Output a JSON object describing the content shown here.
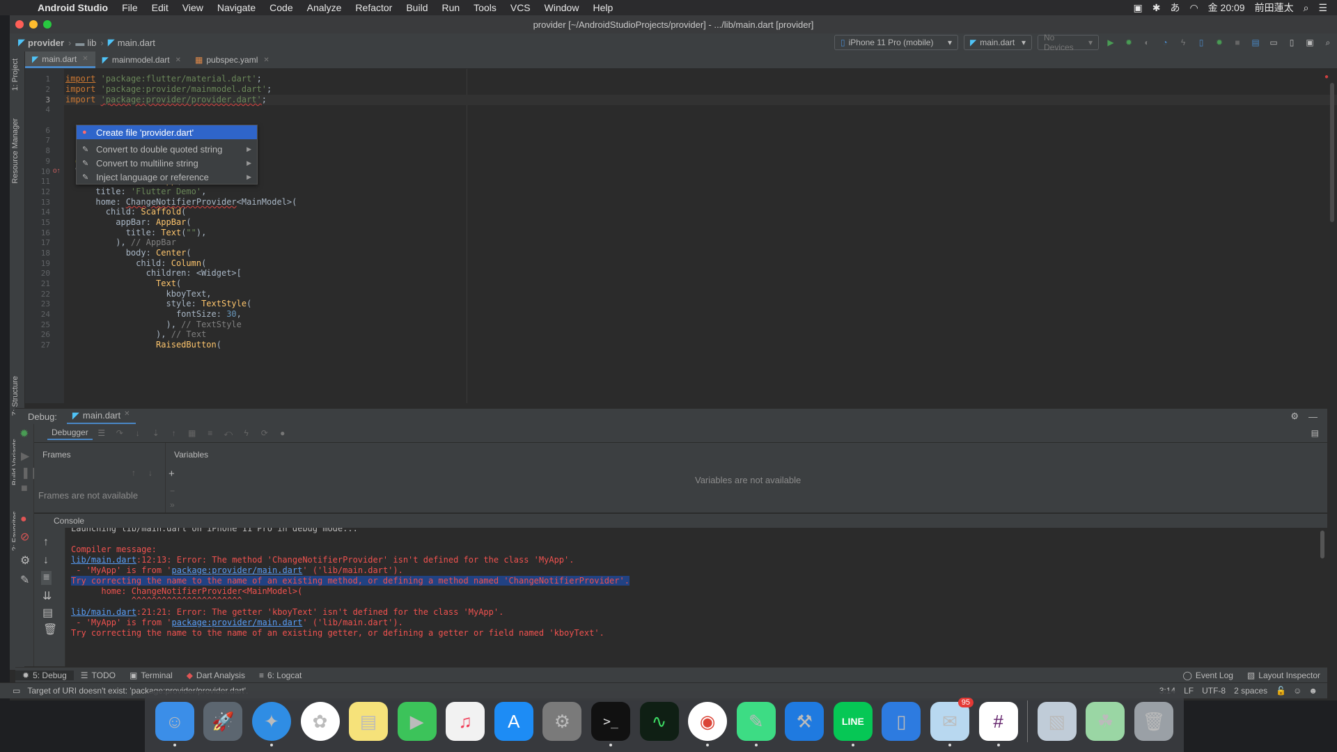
{
  "menubar": {
    "app_name": "Android Studio",
    "items": [
      "File",
      "Edit",
      "View",
      "Navigate",
      "Code",
      "Analyze",
      "Refactor",
      "Build",
      "Run",
      "Tools",
      "VCS",
      "Window",
      "Help"
    ],
    "clock": "金 20:09",
    "user": "前田蓮太"
  },
  "window": {
    "title": "provider [~/AndroidStudioProjects/provider] - .../lib/main.dart [provider]"
  },
  "navbar": {
    "crumbs": [
      "provider",
      "lib",
      "main.dart"
    ],
    "device": "iPhone 11 Pro (mobile)",
    "run_config": "main.dart",
    "devices": "No Devices"
  },
  "left_tabs": [
    "1: Project",
    "Resource Manager",
    "Z: Structure",
    "Build Variants",
    "2: Favorites"
  ],
  "editor_tabs": [
    {
      "label": "main.dart"
    },
    {
      "label": "mainmodel.dart"
    },
    {
      "label": "pubspec.yaml"
    }
  ],
  "code_lines": [
    "1",
    "2",
    "3",
    "4",
    "5",
    "6",
    "7",
    "8",
    "9",
    "10",
    "11",
    "12",
    "13",
    "14",
    "15",
    "16",
    "17",
    "18",
    "19",
    "20",
    "21",
    "22",
    "23",
    "24",
    "25",
    "26",
    "27"
  ],
  "popup": {
    "items": [
      {
        "label": "Create file 'provider.dart'"
      },
      {
        "label": "Convert to double quoted string"
      },
      {
        "label": "Convert to multiline string"
      },
      {
        "label": "Inject language or reference"
      }
    ]
  },
  "debug": {
    "label": "Debug:",
    "tab": "main.dart",
    "debugger_tab": "Debugger",
    "frames_header": "Frames",
    "frames_empty": "Frames are not available",
    "variables_header": "Variables",
    "variables_empty": "Variables are not available",
    "console_label": "Console"
  },
  "console": {
    "launch_line": "Launching lib/main.dart on iPhone 11 Pro in debug mode...",
    "compiler_message": "Compiler message:",
    "err1_link": "lib/main.dart",
    "err1_text": ":12:13: Error: The method 'ChangeNotifierProvider' isn't defined for the class 'MyApp'.",
    "err1_from_pre": " - 'MyApp' is from '",
    "err1_from_link": "package:provider/main.dart",
    "err1_from_post": "' ('lib/main.dart').",
    "err1_try": "Try correcting the name to the name of an existing method, or defining a method named 'ChangeNotifierProvider'.",
    "err1_code": "      home: ChangeNotifierProvider<MainModel>(",
    "err1_squiggle": "            ^^^^^^^^^^^^^^^^^^^^^^",
    "err2_link": "lib/main.dart",
    "err2_text": ":21:21: Error: The getter 'kboyText' isn't defined for the class 'MyApp'.",
    "err2_from_pre": " - 'MyApp' is from '",
    "err2_from_link": "package:provider/main.dart",
    "err2_from_post": "' ('lib/main.dart').",
    "err2_try": "Try correcting the name to the name of an existing getter, or defining a getter or field named 'kboyText'."
  },
  "bottom_tools": {
    "debug": "5: Debug",
    "todo": "TODO",
    "terminal": "Terminal",
    "dart_analysis": "Dart Analysis",
    "logcat": "6: Logcat",
    "event_log": "Event Log",
    "layout_inspector": "Layout Inspector"
  },
  "status": {
    "message": "Target of URI doesn't exist: 'package:provider/provider.dart'.",
    "position": "3:14",
    "line_sep": "LF",
    "encoding": "UTF-8",
    "indent": "2 spaces"
  },
  "dock": {
    "mail_badge": "95"
  }
}
